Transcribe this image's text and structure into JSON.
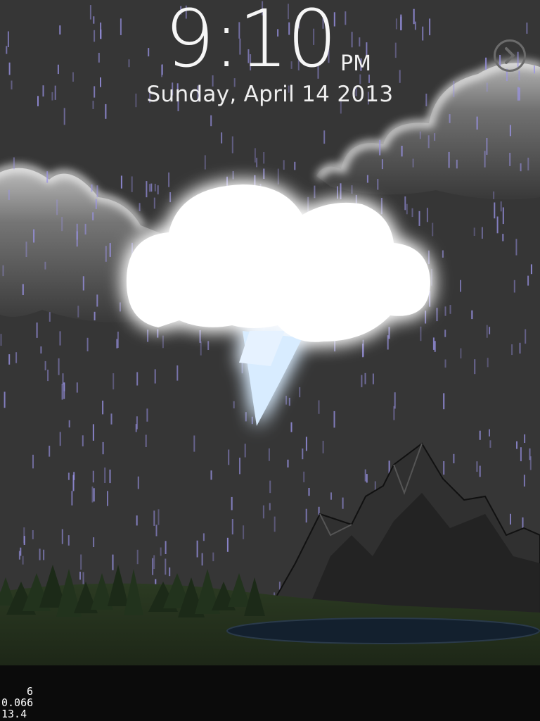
{
  "clock": {
    "time": "9:10",
    "ampm": "PM",
    "date": "Sunday, April 14 2013"
  },
  "controls": {
    "next_icon": "chevron-right-circle-icon"
  },
  "weather": {
    "condition_icon": "thunderstorm-cloud-icon",
    "effect": "rain"
  },
  "debug": {
    "line1": "6",
    "line2": "0.066",
    "line3": "13.4"
  },
  "colors": {
    "sky": "#363636",
    "rain": "#9a93e6",
    "cloud_glow": "#cfe6ff",
    "grass": "#1f2a1a",
    "lake": "#13202e"
  }
}
